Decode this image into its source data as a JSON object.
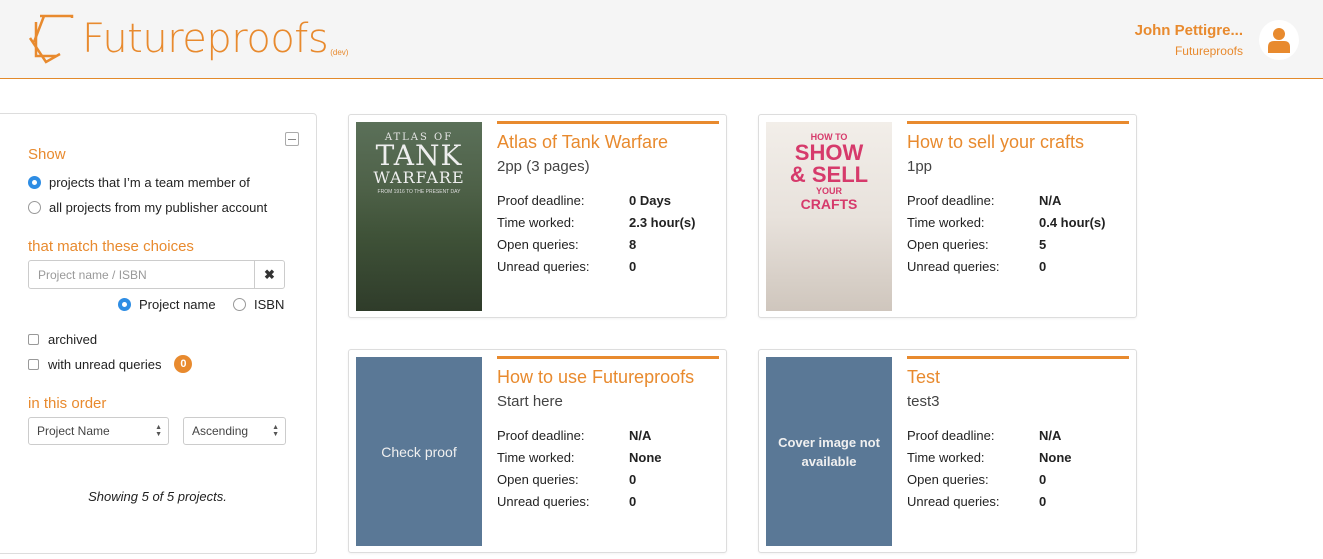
{
  "header": {
    "logo_text": "Futureproofs",
    "logo_badge": "(dev)",
    "user_name": "John Pettigre...",
    "user_org": "Futureproofs"
  },
  "sidebar": {
    "show_title": "Show",
    "show_options": [
      "projects that I’m a team member of",
      "all projects from my publisher account"
    ],
    "match_title": "that match these choices",
    "search_placeholder": "Project name / ISBN",
    "search_clear": "✖",
    "search_type_options": [
      "Project name",
      "ISBN"
    ],
    "archived_label": "archived",
    "unread_label": "with unread queries",
    "unread_count": "0",
    "order_title": "in this order",
    "sort_field": "Project Name",
    "sort_direction": "Ascending",
    "showing_text": "Showing 5 of 5 projects."
  },
  "stat_labels": {
    "deadline": "Proof deadline:",
    "worked": "Time worked:",
    "open": "Open queries:",
    "unread": "Unread queries:"
  },
  "projects": [
    {
      "title": "Atlas of Tank Warfare",
      "subtitle": "2pp (3 pages)",
      "cover_lines": [
        "ATLAS OF",
        "TANK",
        "WARFARE",
        "FROM 1916 TO THE PRESENT DAY"
      ],
      "deadline": "0 Days",
      "worked": "2.3 hour(s)",
      "open": "8",
      "unread": "0"
    },
    {
      "title": "How to sell your crafts",
      "subtitle": "1pp",
      "cover_lines": [
        "HOW TO",
        "SHOW",
        "& SELL",
        "YOUR",
        "CRAFTS"
      ],
      "deadline": "N/A",
      "worked": "0.4 hour(s)",
      "open": "5",
      "unread": "0"
    },
    {
      "title": "How to use Futureproofs",
      "subtitle": "Start here",
      "cover_text": "Check proof",
      "deadline": "N/A",
      "worked": "None",
      "open": "0",
      "unread": "0"
    },
    {
      "title": "Test",
      "subtitle": "test3",
      "cover_text": "Cover image not available",
      "deadline": "N/A",
      "worked": "None",
      "open": "0",
      "unread": "0"
    }
  ],
  "colors": {
    "accent": "#e88a2e",
    "cover_placeholder": "#5a7896",
    "radio_selected": "#2e8de4"
  }
}
